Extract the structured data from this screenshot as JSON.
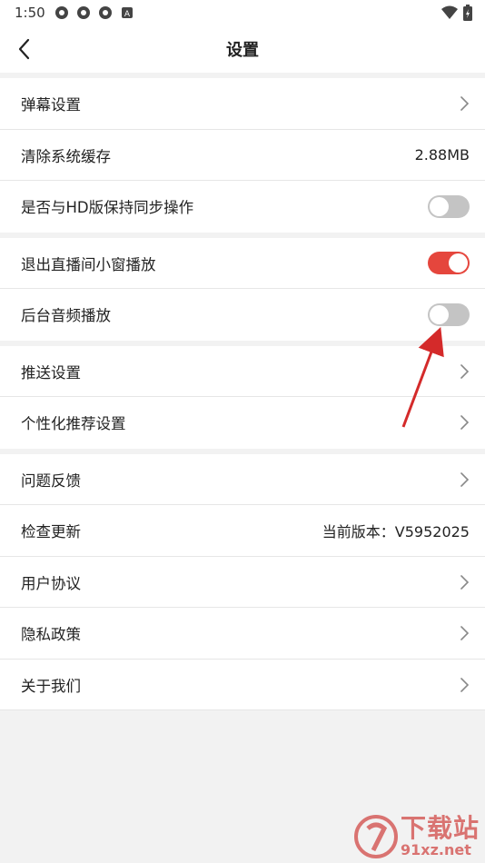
{
  "status_bar": {
    "time": "1:50",
    "icons": [
      "app-icon",
      "app-icon",
      "app-icon",
      "notification-a-icon"
    ],
    "right_icons": [
      "wifi-icon",
      "battery-icon"
    ]
  },
  "nav": {
    "title": "设置",
    "back_icon": "back-chevron-icon"
  },
  "sections": [
    [
      {
        "label": "弹幕设置",
        "type": "link"
      },
      {
        "label": "清除系统缓存",
        "type": "value",
        "value": "2.88MB"
      },
      {
        "label": "是否与HD版保持同步操作",
        "type": "toggle",
        "on": false
      }
    ],
    [
      {
        "label": "退出直播间小窗播放",
        "type": "toggle",
        "on": true
      },
      {
        "label": "后台音频播放",
        "type": "toggle",
        "on": false
      }
    ],
    [
      {
        "label": "推送设置",
        "type": "link"
      },
      {
        "label": "个性化推荐设置",
        "type": "link"
      }
    ],
    [
      {
        "label": "问题反馈",
        "type": "link"
      },
      {
        "label": "检查更新",
        "type": "value",
        "value": "当前版本：V5952025"
      },
      {
        "label": "用户协议",
        "type": "link"
      },
      {
        "label": "隐私政策",
        "type": "link"
      },
      {
        "label": "关于我们",
        "type": "link"
      }
    ]
  ],
  "colors": {
    "toggle_on": "#e5463d",
    "toggle_off": "#c4c4c4",
    "annotation_arrow": "#d42a2a"
  },
  "watermark": {
    "main": "下载站",
    "sub": "91xz.net"
  }
}
